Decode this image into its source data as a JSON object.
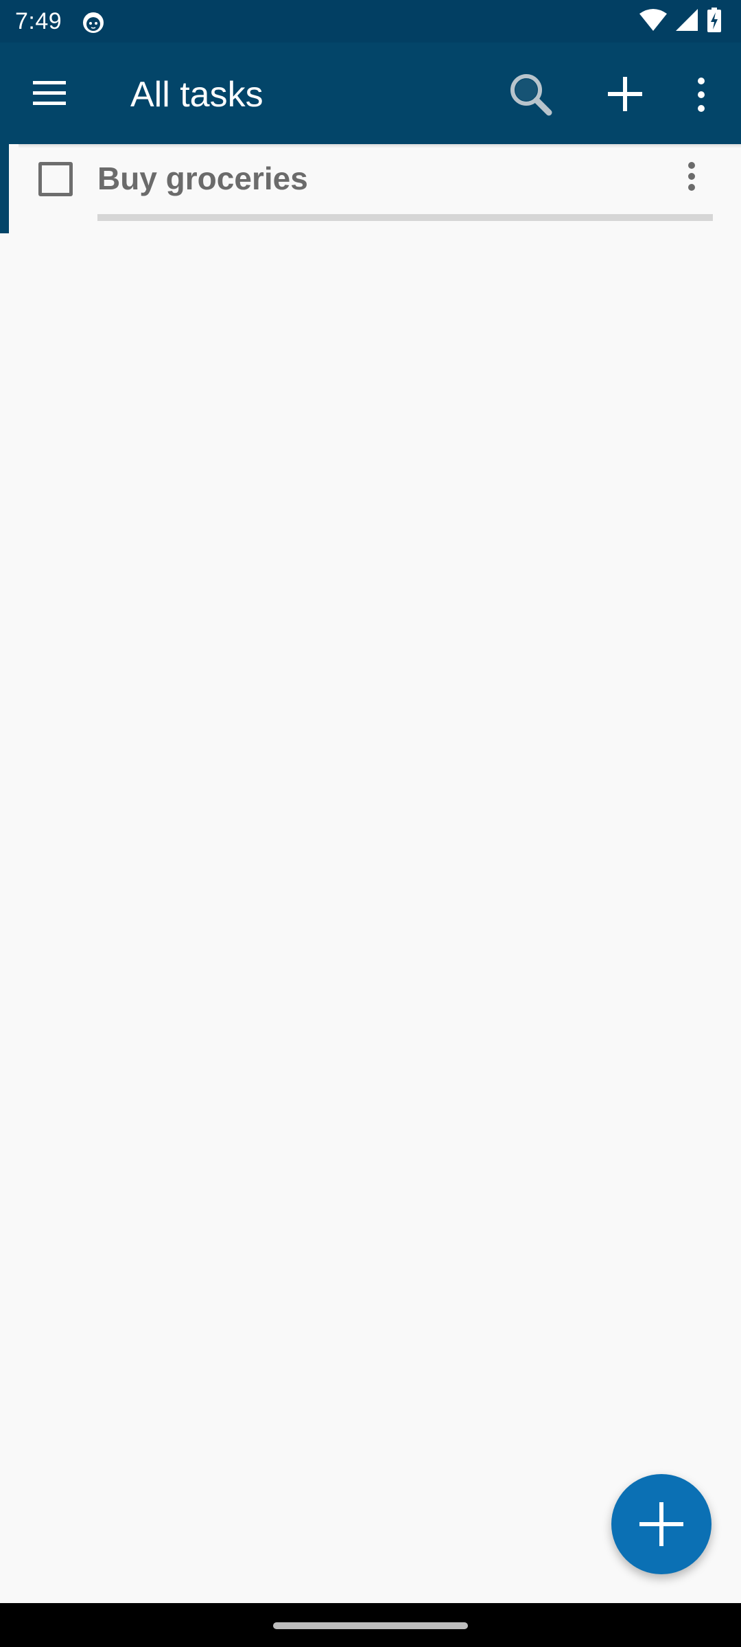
{
  "status_bar": {
    "time": "7:49",
    "app_notification_icon": "cat-face-icon",
    "indicators": [
      "wifi-icon",
      "cell-signal-icon",
      "battery-charging-icon"
    ]
  },
  "app_bar": {
    "title": "All tasks",
    "actions": [
      "menu-icon",
      "search-icon",
      "add-icon",
      "overflow-menu-icon"
    ]
  },
  "tasks": [
    {
      "title": "Buy groceries",
      "checked": false
    }
  ],
  "fab": {
    "icon": "plus-icon"
  },
  "colors": {
    "status_bar": "#023f63",
    "app_bar": "#034569",
    "fab": "#0b70b4",
    "background": "#f9f9f9",
    "task_text": "#6b6b6b"
  }
}
